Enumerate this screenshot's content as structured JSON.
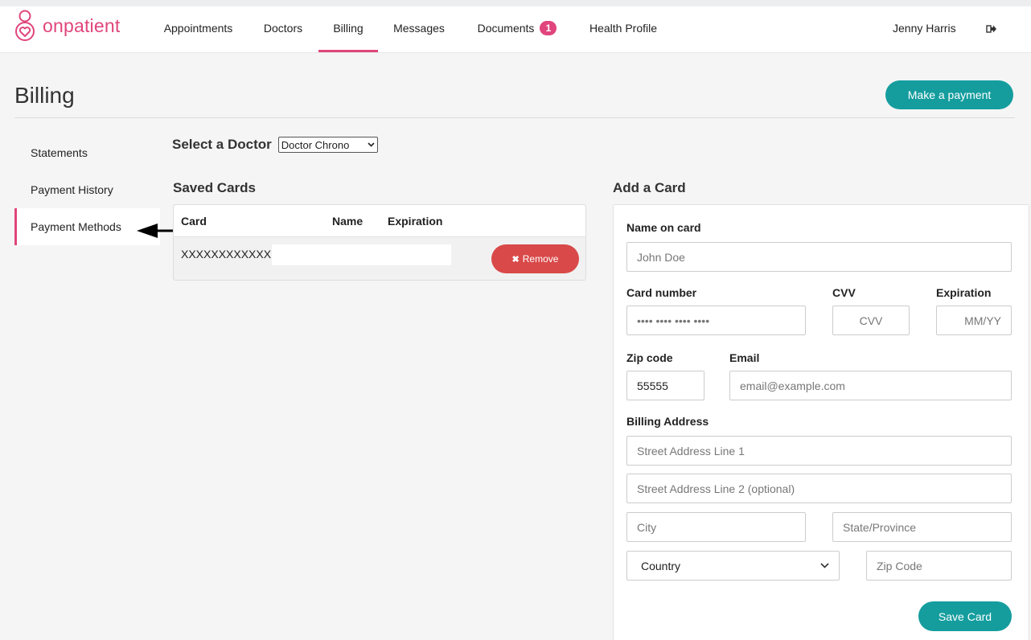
{
  "app": {
    "logo_text": "onpatient",
    "user_name": "Jenny Harris"
  },
  "nav": {
    "items": [
      {
        "label": "Appointments"
      },
      {
        "label": "Doctors"
      },
      {
        "label": "Billing",
        "active": true
      },
      {
        "label": "Messages"
      },
      {
        "label": "Documents",
        "badge": "1"
      },
      {
        "label": "Health Profile"
      }
    ]
  },
  "page": {
    "title": "Billing",
    "make_payment_label": "Make a payment"
  },
  "sidebar": {
    "items": [
      {
        "label": "Statements"
      },
      {
        "label": "Payment History"
      },
      {
        "label": "Payment Methods",
        "active": true
      }
    ]
  },
  "doctor_select": {
    "label": "Select a Doctor",
    "selected": "Doctor Chrono"
  },
  "saved_cards": {
    "heading": "Saved Cards",
    "columns": [
      "Card",
      "Name",
      "Expiration"
    ],
    "rows": [
      {
        "card": "XXXXXXXXXXXX",
        "remove_label": "Remove"
      }
    ]
  },
  "add_card": {
    "heading": "Add a Card",
    "name_label": "Name on card",
    "name_placeholder": "John Doe",
    "card_number_label": "Card number",
    "card_number_placeholder": "•••• •••• •••• ••••",
    "cvv_label": "CVV",
    "cvv_placeholder": "CVV",
    "expiration_label": "Expiration",
    "expiration_placeholder": "MM/YY",
    "zip_label": "Zip code",
    "zip_value": "55555",
    "email_label": "Email",
    "email_placeholder": "email@example.com",
    "billing_address_label": "Billing Address",
    "street1_placeholder": "Street Address Line 1",
    "street2_placeholder": "Street Address Line 2 (optional)",
    "city_placeholder": "City",
    "state_placeholder": "State/Province",
    "country_value": "Country",
    "zip_code_placeholder": "Zip Code",
    "save_label": "Save Card"
  },
  "colors": {
    "brand_pink": "#e0457b",
    "teal": "#159d9e",
    "remove_red": "#d94949"
  },
  "icons": {
    "logo": "onpatient-heart-logo-icon",
    "logout": "logout-icon",
    "arrow": "left-arrow-annotation-icon",
    "remove": "x-icon",
    "select": "chevron-down-icon"
  }
}
